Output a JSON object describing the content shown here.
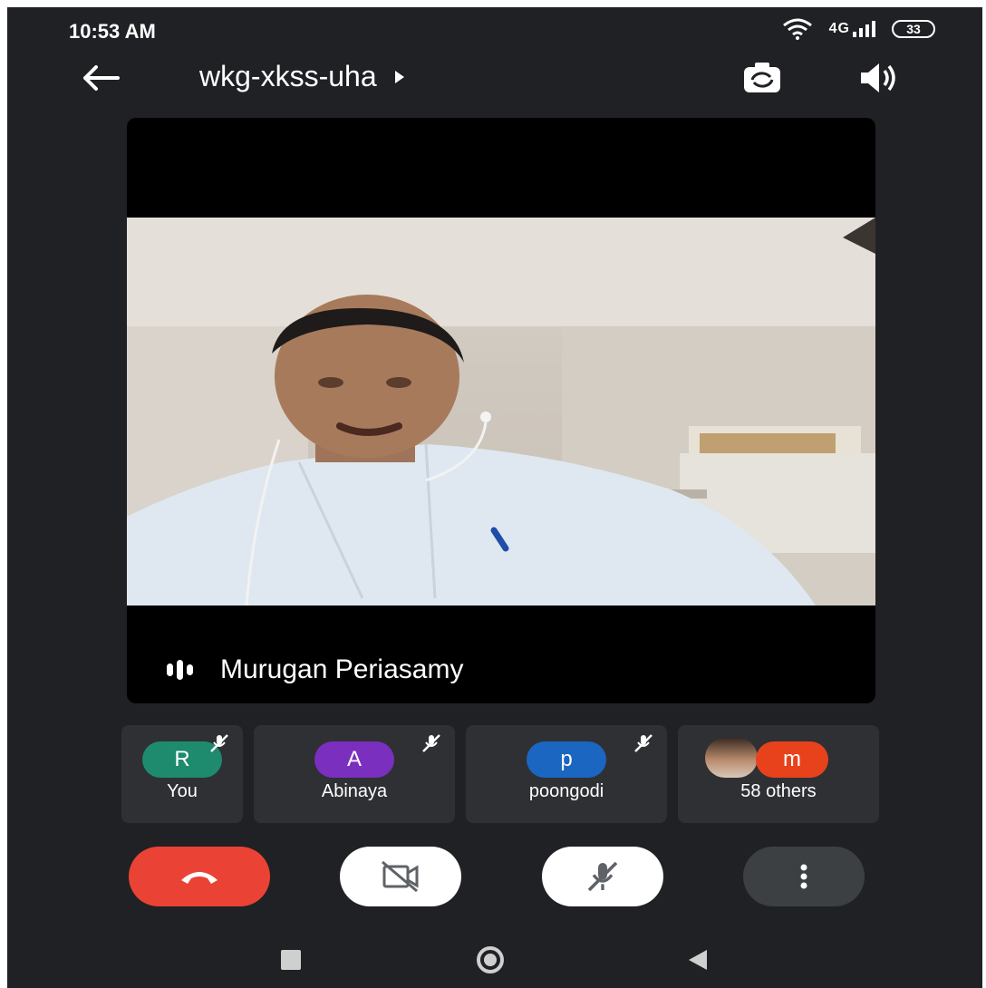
{
  "status_bar": {
    "time": "10:53 AM",
    "network": "4G",
    "battery": "33"
  },
  "top_bar": {
    "meeting_code": "wkg-xkss-uha"
  },
  "main_speaker": {
    "name": "Murugan Periasamy"
  },
  "participants": [
    {
      "initial": "R",
      "name": "You",
      "color": "#1e8a6e",
      "muted": true
    },
    {
      "initial": "A",
      "name": "Abinaya",
      "color": "#7b2fbe",
      "muted": true
    },
    {
      "initial": "p",
      "name": "poongodi",
      "color": "#1a66c0",
      "muted": true
    },
    {
      "initial": "m",
      "name": "58 others",
      "color": "#e8421c",
      "muted": false
    }
  ],
  "controls": {
    "end_call_color": "#ea4335",
    "camera_state": "off",
    "mic_state": "muted",
    "more_icon": "more-vert-icon"
  },
  "icons": {
    "back": "arrow-back-icon",
    "switch_camera": "switch-camera-icon",
    "speaker": "volume-icon",
    "wifi": "wifi-icon",
    "signal": "signal-icon"
  }
}
